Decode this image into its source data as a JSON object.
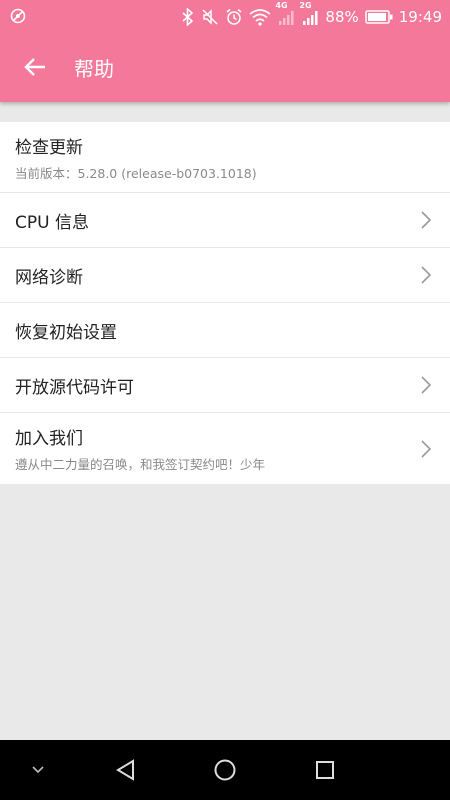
{
  "status_bar": {
    "battery_percent": "88%",
    "time": "19:49",
    "net1": "4G",
    "net2": "2G"
  },
  "toolbar": {
    "title": "帮助"
  },
  "list": {
    "items": [
      {
        "title": "检查更新",
        "subtitle": "当前版本：5.28.0    (release-b0703.1018)",
        "chevron": false
      },
      {
        "title": "CPU 信息",
        "subtitle": "",
        "chevron": true
      },
      {
        "title": "网络诊断",
        "subtitle": "",
        "chevron": true
      },
      {
        "title": "恢复初始设置",
        "subtitle": "",
        "chevron": false
      },
      {
        "title": "开放源代码许可",
        "subtitle": "",
        "chevron": true
      },
      {
        "title": "加入我们",
        "subtitle": "遵从中二力量的召唤，和我签订契约吧！少年",
        "chevron": true
      }
    ]
  },
  "colors": {
    "accent": "#f4789a",
    "background": "#e9e9e9"
  },
  "icons": {
    "back": "arrow-left-icon",
    "chevron": "chevron-right-icon"
  }
}
